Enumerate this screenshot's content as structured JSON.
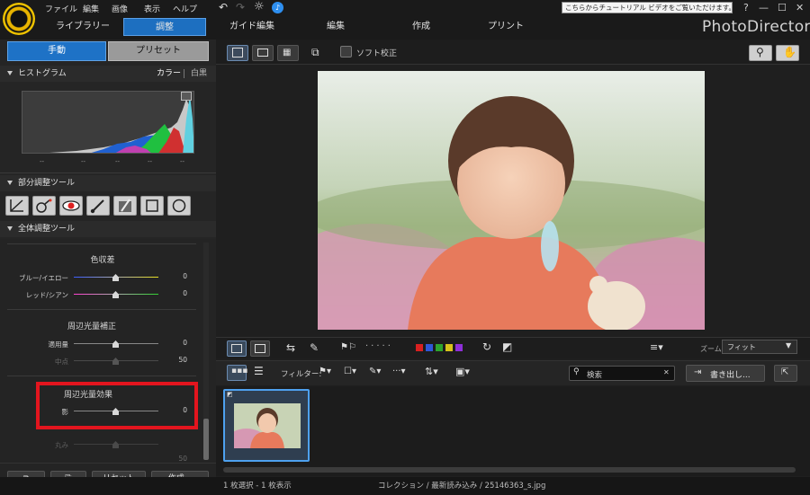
{
  "menu": {
    "file": "ファイル",
    "edit": "編集",
    "image": "画像",
    "view": "表示",
    "help": "ヘルプ"
  },
  "tooltip": "こちらからチュートリアル ビデオをご覧いただけます。",
  "window": {
    "help": "?",
    "minimize": "—",
    "maximize": "☐",
    "close": "✕"
  },
  "modules": {
    "library": "ライブラリー",
    "adjust": "調整",
    "guided": "ガイド編集",
    "edit": "編集",
    "create": "作成",
    "print": "プリント"
  },
  "brand": "PhotoDirector",
  "left": {
    "tab_manual": "手動",
    "tab_preset": "プリセット",
    "histogram": {
      "title": "ヒストグラム",
      "color": "カラー",
      "mono": "白黒",
      "ticks": [
        "--",
        "--",
        "--",
        "--",
        "--"
      ]
    },
    "regional": {
      "title": "部分調整ツール"
    },
    "global": {
      "title": "全体調整ツール"
    },
    "chromatic": {
      "title": "色収差",
      "rows": [
        {
          "label": "ブルー/イエロー",
          "value": "0"
        },
        {
          "label": "レッド/シアン",
          "value": "0"
        }
      ]
    },
    "vignette_correction": {
      "title": "周辺光量補正",
      "rows": [
        {
          "label": "適用量",
          "value": "0"
        },
        {
          "label": "中点",
          "value": "50"
        }
      ]
    },
    "vignette_effect": {
      "title": "周辺光量効果",
      "rows": [
        {
          "label": "影",
          "value": "0"
        },
        {
          "label": "丸み",
          "value": ""
        }
      ],
      "faded_value": "50"
    },
    "buttons": {
      "reset": "リセット",
      "create": "作成..."
    }
  },
  "main": {
    "soft_proof": "ソフト校正",
    "zoom_label": "ズーム:",
    "zoom_value": "フィット",
    "filter_label": "フィルター:",
    "search_placeholder": "検索",
    "export": "書き出し...",
    "color_labels": [
      "#d92020",
      "#2f57d8",
      "#2da42d",
      "#d8c21a",
      "#8e2fd8"
    ]
  },
  "status": {
    "selection": "1 枚選択 - 1 枚表示",
    "path": "コレクション / 最新読み込み / 25146363_s.jpg"
  }
}
